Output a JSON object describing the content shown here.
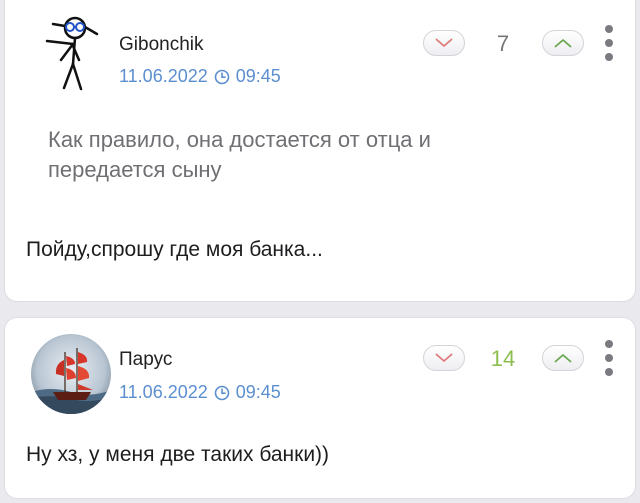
{
  "comments": [
    {
      "username": "Gibonchik",
      "date": "11.06.2022",
      "time": "09:45",
      "score": "7",
      "quote": "Как правило, она достается от отца и передается сыну",
      "text": "Пойду,спрошу где моя банка...",
      "avatar_icon": "stick-figure-avatar"
    },
    {
      "username": "Парус",
      "date": "11.06.2022",
      "time": "09:45",
      "score": "14",
      "text": "Ну хз, у меня две таких банки))",
      "avatar_icon": "red-sail-ship-avatar"
    }
  ],
  "colors": {
    "background": "#e9e9ee",
    "date_link": "#5b8fd0",
    "score_neutral": "#777777",
    "score_positive": "#8cbd4e",
    "downvote": "#e07a7a",
    "upvote": "#6aa84f"
  }
}
